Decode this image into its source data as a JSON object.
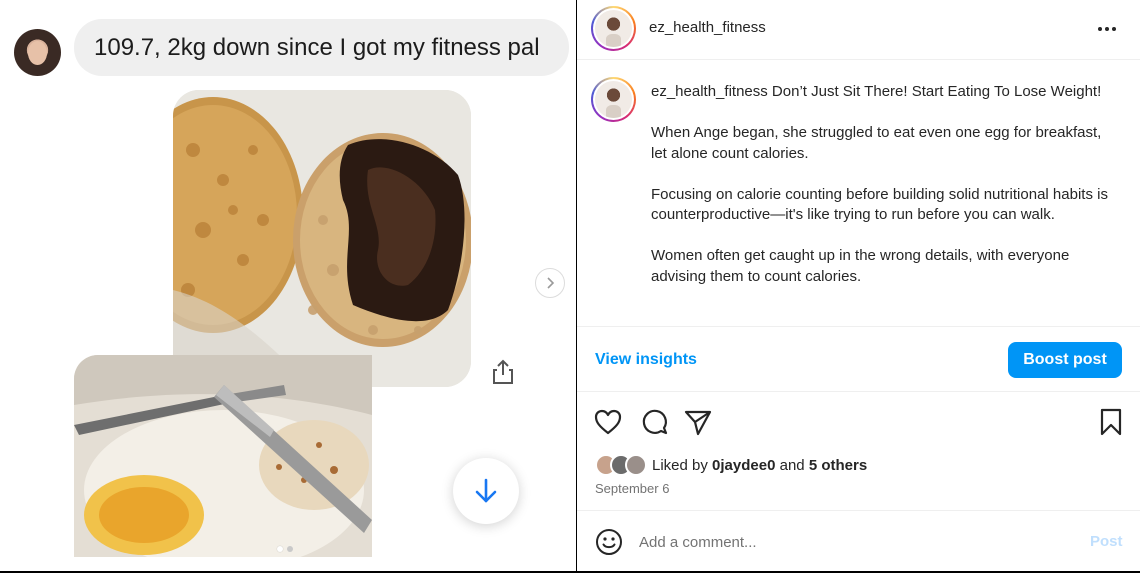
{
  "message": {
    "text": "109.7, 2kg down since I got my fitness pal"
  },
  "post": {
    "username": "ez_health_fitness",
    "caption": {
      "username": "ez_health_fitness",
      "first_line": "Don’t Just Sit There! Start Eating To Lose Weight!",
      "paragraphs": [
        "When Ange began, she struggled to eat even one egg for breakfast, let alone count calories.",
        "Focusing on calorie counting before building solid nutritional habits is counterproductive—it's like trying to run before you can walk.",
        "Women often get caught up in the wrong details, with everyone advising them to count calories."
      ]
    },
    "insights_label": "View insights",
    "boost_label": "Boost post",
    "likes": {
      "prefix": "Liked by",
      "user": "0jaydee0",
      "joiner": "and",
      "others": "5 others"
    },
    "date": "September 6",
    "comment": {
      "placeholder": "Add a comment...",
      "post_label": "Post"
    }
  },
  "carousel": {
    "total": 2,
    "current": 1
  },
  "icons": {
    "like": "heart-icon",
    "comment": "comment-icon",
    "share": "send-icon",
    "save": "bookmark-icon",
    "more": "more-icon",
    "emoji": "emoji-icon",
    "next": "chevron-right-icon",
    "scroll": "arrow-down-icon",
    "share_media": "share-icon"
  },
  "colors": {
    "accent": "#0095f6",
    "post_disabled": "#c0dffd",
    "muted": "#737373"
  }
}
